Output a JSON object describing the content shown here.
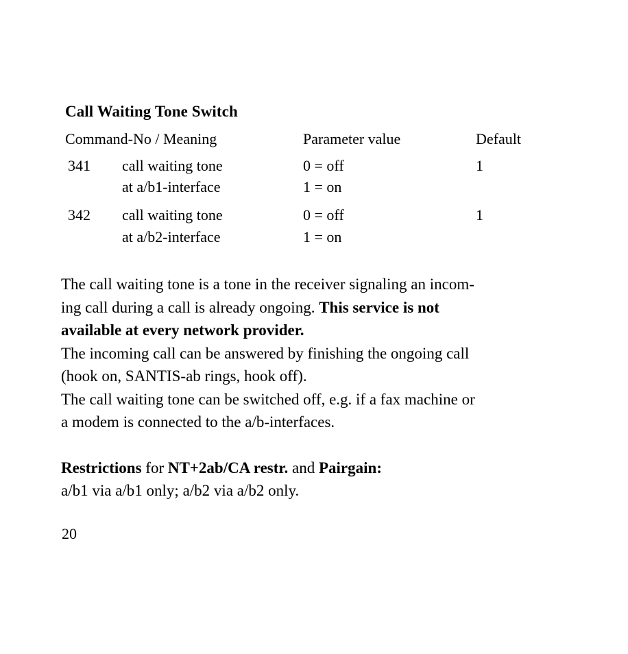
{
  "document": {
    "page_number": "20"
  },
  "table": {
    "title": "Call Waiting Tone Switch",
    "headers": {
      "command": "Command-No / Meaning",
      "parameter": "Parameter value",
      "default": "Default"
    },
    "rows": [
      {
        "number": "341",
        "meaning_line1": "call waiting tone",
        "meaning_line2": "at a/b1-interface",
        "param_line1": "0 = off",
        "param_line2": "1 = on",
        "default": "1"
      },
      {
        "number": "342",
        "meaning_line1": "call waiting tone",
        "meaning_line2": "at a/b2-interface",
        "param_line1": "0 = off",
        "param_line2": "1 = on",
        "default": "1"
      }
    ]
  },
  "body": {
    "paragraph1": {
      "line1": "The call waiting tone is a tone in the receiver signaling an incom-",
      "line2_plain": "ing call during a call is already ongoing. ",
      "line2_bold": "This service is not",
      "line3_bold": "available at every network provider."
    },
    "paragraph2": {
      "line1": "The incoming call can be answered by finishing the ongoing call",
      "line2": "(hook on, SANTIS-ab rings, hook off)."
    },
    "paragraph3": {
      "line1": "The call waiting tone can be switched off, e.g. if a fax machine or",
      "line2": "a modem is connected to the a/b-interfaces."
    },
    "restrictions": {
      "label_bold": "Restrictions",
      "connector1": " for ",
      "product_bold": "NT+2ab/CA restr.",
      "connector2": " and ",
      "pairgain_bold": "Pairgain:",
      "detail": "a/b1 via a/b1 only; a/b2 via a/b2 only."
    }
  }
}
